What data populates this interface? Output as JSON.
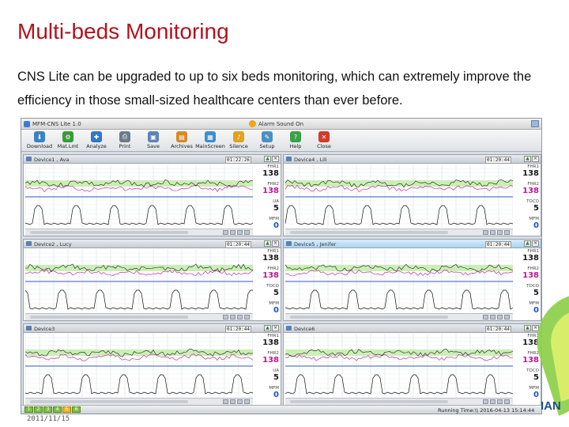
{
  "slide": {
    "title": "Multi-beds Monitoring",
    "body": "CNS Lite can be upgraded to up to six beds monitoring, which can extremely improve the efficiency in those small-sized healthcare centers than ever before.",
    "date": "2011/11/15",
    "brand": "IAN"
  },
  "app": {
    "title": "MFM-CNS Lite 1.0",
    "alarm": "Alarm Sound On",
    "toolbar": [
      {
        "label": "Download",
        "icon": "download-icon",
        "color": "#3b82c4",
        "glyph": "⬇"
      },
      {
        "label": "Mat.Lmt",
        "icon": "limit-icon",
        "color": "#3a9a3a",
        "glyph": "⚙"
      },
      {
        "label": "Analyze",
        "icon": "analyze-icon",
        "color": "#2f78c6",
        "glyph": "✚"
      },
      {
        "label": "Print",
        "icon": "print-icon",
        "color": "#6b7b8c",
        "glyph": "⎙"
      },
      {
        "label": "Save",
        "icon": "save-icon",
        "color": "#5d84b8",
        "glyph": "▣"
      },
      {
        "label": "Archives",
        "icon": "archives-icon",
        "color": "#d58a2a",
        "glyph": "▤"
      },
      {
        "label": "MainScreen",
        "icon": "mainscreen-icon",
        "color": "#3a8fd0",
        "glyph": "▦"
      },
      {
        "label": "Silence",
        "icon": "silence-icon",
        "color": "#e3a21b",
        "glyph": "♪"
      },
      {
        "label": "Setup",
        "icon": "setup-icon",
        "color": "#4a90c2",
        "glyph": "✎"
      },
      {
        "label": "Help",
        "icon": "help-icon",
        "color": "#3aa14a",
        "glyph": "?"
      },
      {
        "label": "Close",
        "icon": "close-icon",
        "color": "#d23a2a",
        "glyph": "✕"
      }
    ],
    "panels": [
      {
        "name": "Device1 , Ava",
        "time": "01:22:26",
        "selected": false,
        "vitals": [
          {
            "label": "FHR1",
            "value": "138",
            "color": "#1a1a1a"
          },
          {
            "label": "FHR2",
            "value": "138",
            "color": "#c0139c"
          },
          {
            "label": "UA",
            "value": "5",
            "color": "#1a1a1a"
          },
          {
            "label": "MFM",
            "value": "0",
            "color": "#1e4fd6"
          }
        ]
      },
      {
        "name": "Device4 , Lili",
        "time": "01:20:44",
        "selected": false,
        "vitals": [
          {
            "label": "FHR1",
            "value": "138",
            "color": "#1a1a1a"
          },
          {
            "label": "FHR2",
            "value": "138",
            "color": "#c0139c"
          },
          {
            "label": "TOCO",
            "value": "5",
            "color": "#1a1a1a"
          },
          {
            "label": "MFM",
            "value": "0",
            "color": "#1e4fd6"
          }
        ]
      },
      {
        "name": "Device2 , Lucy",
        "time": "01:20:44",
        "selected": false,
        "vitals": [
          {
            "label": "FHR1",
            "value": "138",
            "color": "#1a1a1a"
          },
          {
            "label": "FHR2",
            "value": "138",
            "color": "#c0139c"
          },
          {
            "label": "TOCO",
            "value": "5",
            "color": "#1a1a1a"
          },
          {
            "label": "MFM",
            "value": "0",
            "color": "#1e4fd6"
          }
        ]
      },
      {
        "name": "Device5 , Jenifer",
        "time": "01:20:44",
        "selected": true,
        "vitals": [
          {
            "label": "FHR1",
            "value": "138",
            "color": "#1a1a1a"
          },
          {
            "label": "FHR2",
            "value": "138",
            "color": "#c0139c"
          },
          {
            "label": "TOCO",
            "value": "5",
            "color": "#1a1a1a"
          },
          {
            "label": "MFM",
            "value": "0",
            "color": "#1e4fd6"
          }
        ]
      },
      {
        "name": "Device3",
        "time": "01:20:44",
        "selected": false,
        "vitals": [
          {
            "label": "FHR1",
            "value": "138",
            "color": "#1a1a1a"
          },
          {
            "label": "FHR2",
            "value": "138",
            "color": "#c0139c"
          },
          {
            "label": "UA",
            "value": "5",
            "color": "#1a1a1a"
          },
          {
            "label": "MFM",
            "value": "0",
            "color": "#1e4fd6"
          }
        ]
      },
      {
        "name": "Device6",
        "time": "01:20:44",
        "selected": false,
        "vitals": [
          {
            "label": "FHR1",
            "value": "138",
            "color": "#1a1a1a"
          },
          {
            "label": "FHR2",
            "value": "138",
            "color": "#c0139c"
          },
          {
            "label": "TOCO",
            "value": "5",
            "color": "#1a1a1a"
          },
          {
            "label": "MFM",
            "value": "0",
            "color": "#1e4fd6"
          }
        ]
      }
    ],
    "status": {
      "tabs": [
        "1",
        "2",
        "3",
        "4",
        "5",
        "6"
      ],
      "active_tab": "5",
      "running": "Running Time:\\\\ 2016-04-13 15:14:44"
    }
  },
  "colors": {
    "title": "#b3121c",
    "fhr1": "#1a1a1a",
    "fhr2": "#c0139c",
    "mfm": "#1e4fd6",
    "band": "#c9f0b0",
    "leaf": "#8fd14f"
  }
}
